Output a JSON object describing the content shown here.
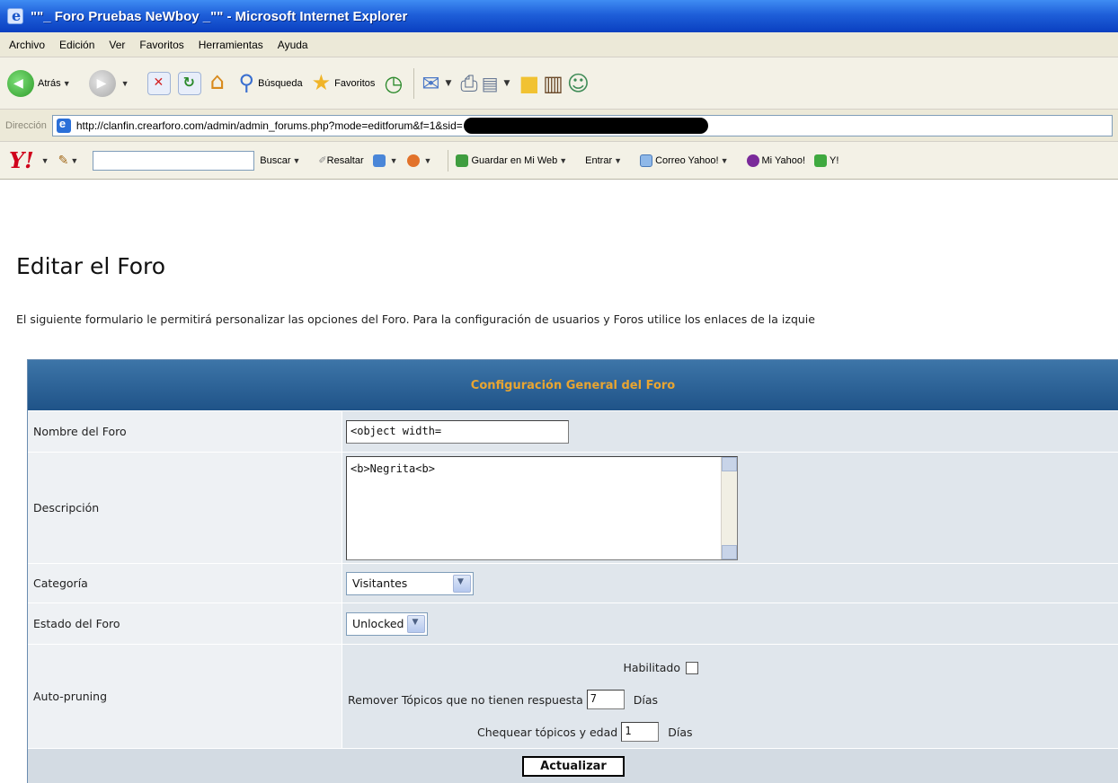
{
  "window": {
    "title": "\"\"_ Foro Pruebas NeWboy _\"\" - Microsoft Internet Explorer"
  },
  "menu": [
    "Archivo",
    "Edición",
    "Ver",
    "Favoritos",
    "Herramientas",
    "Ayuda"
  ],
  "toolbar": {
    "back_label": "Atrás",
    "search_label": "Búsqueda",
    "favorites_label": "Favoritos"
  },
  "address": {
    "label": "Dirección",
    "url": "http://clanfin.crearforo.com/admin/admin_forums.php?mode=editforum&f=1&sid="
  },
  "yahoo": {
    "logo": "Y!",
    "buscar": "Buscar",
    "resaltar": "Resaltar",
    "guardar": "Guardar en Mi Web",
    "entrar": "Entrar",
    "correo": "Correo Yahoo!",
    "mi_yahoo": "Mi Yahoo!",
    "trailing": "Y!"
  },
  "page": {
    "title": "Editar el Foro",
    "description": "El siguiente formulario le permitirá personalizar las opciones del Foro. Para la configuración de usuarios y Foros utilice los enlaces de la izquie"
  },
  "form": {
    "header": "Configuración General del Foro",
    "fields": {
      "name_label": "Nombre del Foro",
      "name_value": "<object width=",
      "desc_label": "Descripción",
      "desc_value": "<b>Negrita<b>",
      "category_label": "Categoría",
      "category_value": "Visitantes",
      "status_label": "Estado del Foro",
      "status_value": "Unlocked",
      "prune_label": "Auto-pruning",
      "prune_enabled_label": "Habilitado",
      "prune_enabled": false,
      "prune_remove_label": "Remover Tópicos que no tienen respuesta",
      "prune_remove_value": "7",
      "prune_remove_unit": "Días",
      "prune_check_label": "Chequear tópicos y edad",
      "prune_check_value": "1",
      "prune_check_unit": "Días"
    },
    "submit_label": "Actualizar"
  }
}
